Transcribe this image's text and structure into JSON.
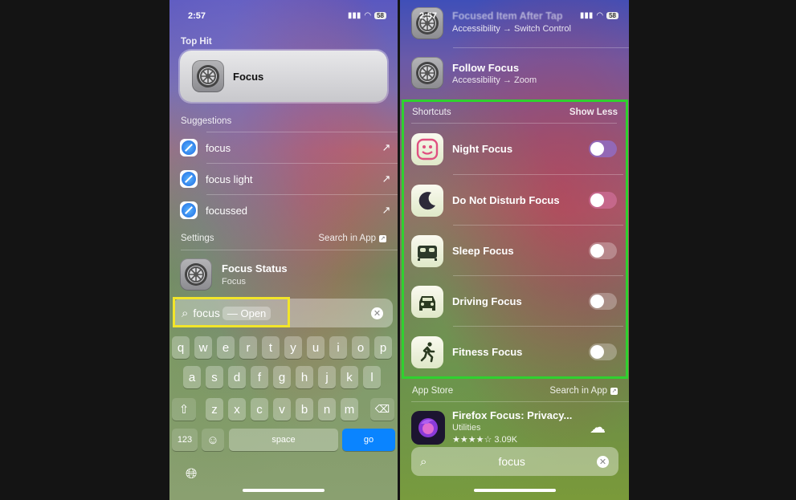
{
  "left": {
    "status": {
      "time": "2:57",
      "battery": "58"
    },
    "top_hit": {
      "section": "Top Hit",
      "title": "Focus"
    },
    "suggestions": {
      "section": "Suggestions",
      "items": [
        {
          "label": "focus"
        },
        {
          "label": "focus light"
        },
        {
          "label": "focussed"
        }
      ]
    },
    "settings": {
      "section": "Settings",
      "search_in_app": "Search in App",
      "result": {
        "title": "Focus Status",
        "subtitle": "Focus"
      }
    },
    "search": {
      "value": "focus",
      "hint": "— Open"
    },
    "keyboard": {
      "row1": [
        "q",
        "w",
        "e",
        "r",
        "t",
        "y",
        "u",
        "i",
        "o",
        "p"
      ],
      "row2": [
        "a",
        "s",
        "d",
        "f",
        "g",
        "h",
        "j",
        "k",
        "l"
      ],
      "row3": [
        "z",
        "x",
        "c",
        "v",
        "b",
        "n",
        "m"
      ],
      "numbers_key": "123",
      "space_key": "space",
      "go_key": "go"
    }
  },
  "right": {
    "status": {
      "time": "2:57",
      "battery": "58"
    },
    "results": [
      {
        "title": "Focused Item After Tap",
        "subtitle": "Accessibility → Switch Control"
      },
      {
        "title": "Follow Focus",
        "subtitle": "Accessibility → Zoom"
      }
    ],
    "shortcuts": {
      "section": "Shortcuts",
      "show_less": "Show Less",
      "items": [
        {
          "label": "Night Focus",
          "icon": "smiley-icon",
          "on": false
        },
        {
          "label": "Do Not Disturb Focus",
          "icon": "moon-icon",
          "on": false
        },
        {
          "label": "Sleep Focus",
          "icon": "bed-icon",
          "on": false
        },
        {
          "label": "Driving Focus",
          "icon": "car-icon",
          "on": false
        },
        {
          "label": "Fitness Focus",
          "icon": "running-figure-icon",
          "on": false
        }
      ]
    },
    "app_store": {
      "section": "App Store",
      "search_in_app": "Search in App",
      "app": {
        "title": "Firefox Focus: Privacy...",
        "category": "Utilities",
        "stars": "★★★★☆",
        "rating_count": "3.09K"
      }
    },
    "search": {
      "value": "focus"
    }
  },
  "colors": {
    "highlight_yellow": "#f2e52a",
    "highlight_green": "#2fd12f",
    "go_key_blue": "#0a84ff"
  }
}
